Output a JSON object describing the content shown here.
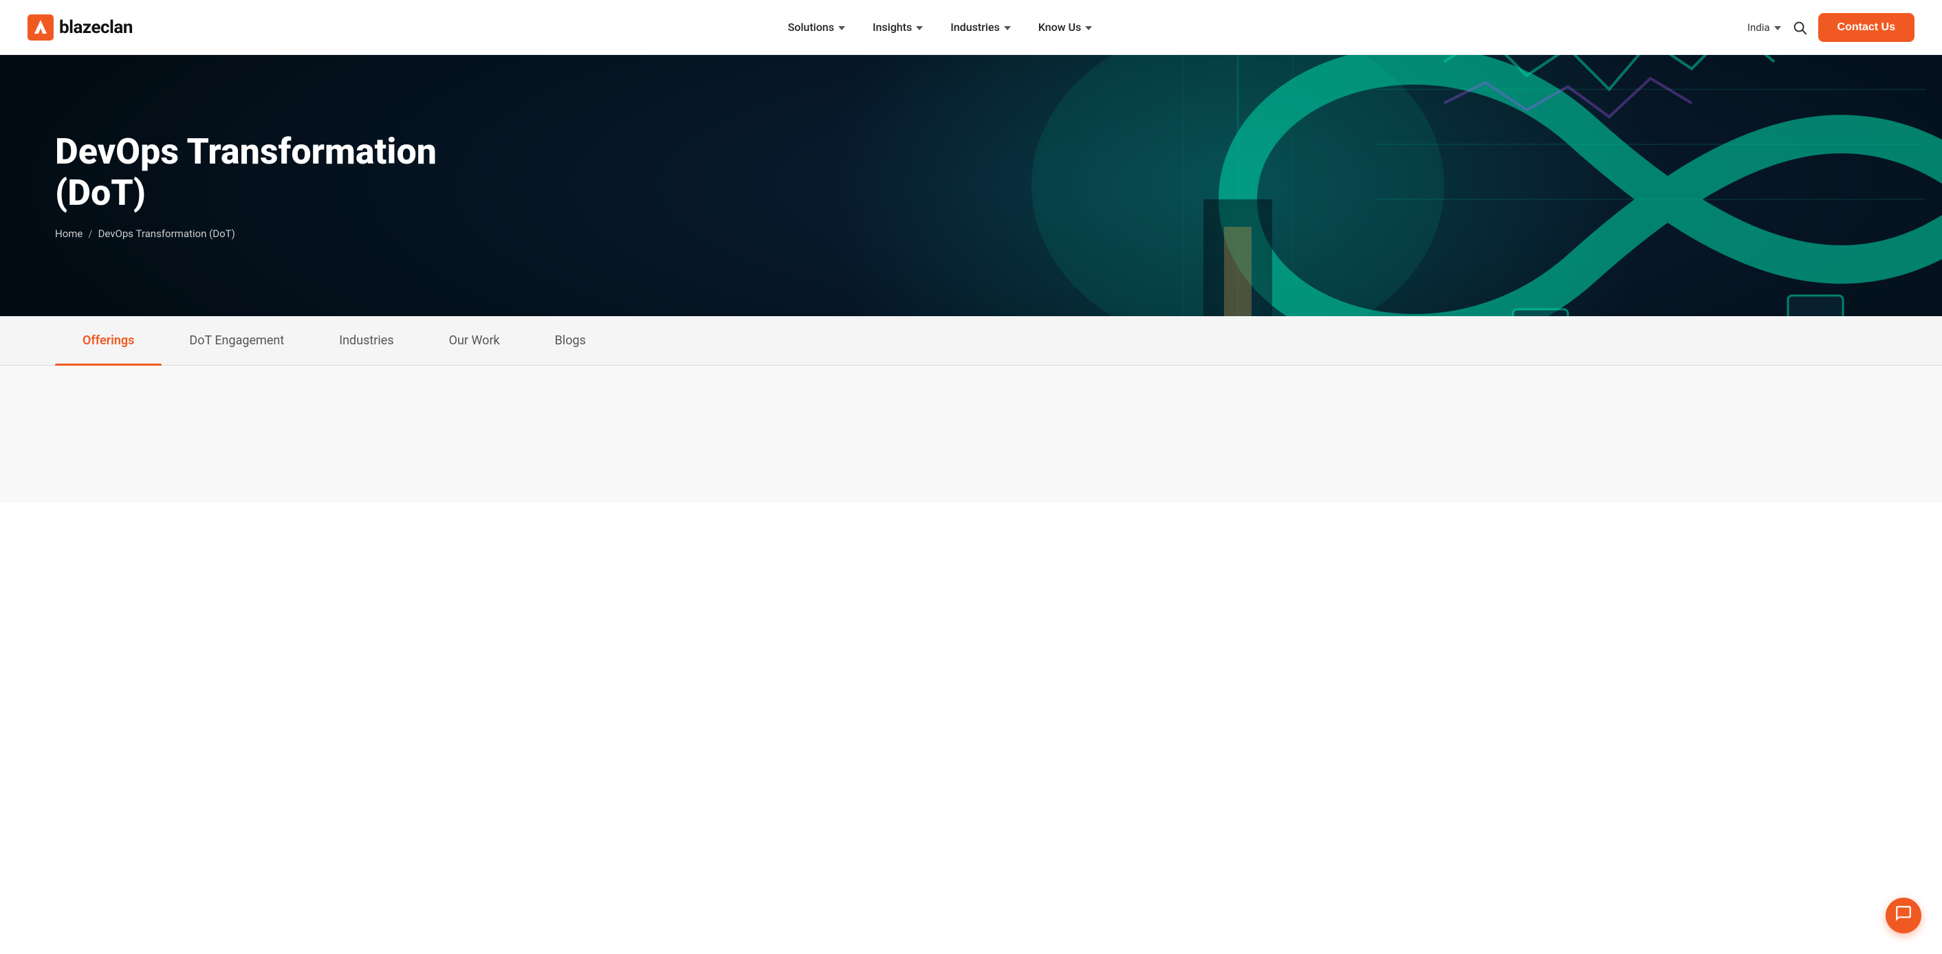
{
  "brand": {
    "name": "blazeclan",
    "logo_alt": "Blazeclan logo"
  },
  "navbar": {
    "nav_items": [
      {
        "id": "solutions",
        "label": "Solutions",
        "has_dropdown": true
      },
      {
        "id": "insights",
        "label": "Insights",
        "has_dropdown": true
      },
      {
        "id": "industries",
        "label": "Industries",
        "has_dropdown": true
      },
      {
        "id": "know_us",
        "label": "Know Us",
        "has_dropdown": true
      }
    ],
    "region": "India",
    "contact_label": "Contact Us"
  },
  "hero": {
    "title": "DevOps Transformation (DoT)",
    "breadcrumb": {
      "home": "Home",
      "separator": "/",
      "current": "DevOps Transformation (DoT)"
    }
  },
  "sub_nav": {
    "tabs": [
      {
        "id": "offerings",
        "label": "Offerings",
        "active": true
      },
      {
        "id": "dot_engagement",
        "label": "DoT Engagement",
        "active": false
      },
      {
        "id": "industries",
        "label": "Industries",
        "active": false
      },
      {
        "id": "our_work",
        "label": "Our Work",
        "active": false
      },
      {
        "id": "blogs",
        "label": "Blogs",
        "active": false
      }
    ]
  },
  "colors": {
    "accent": "#f05a22",
    "hero_bg": "#05101e",
    "nav_text": "#222",
    "muted_text": "#555"
  },
  "chat": {
    "icon": "💬"
  }
}
